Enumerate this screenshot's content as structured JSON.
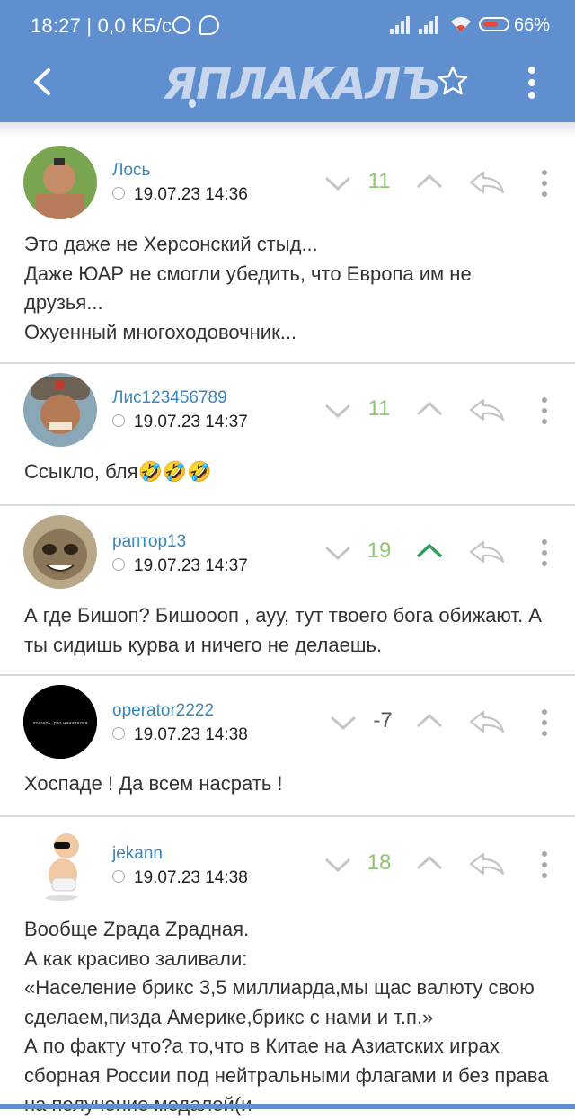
{
  "status_bar": {
    "time_text": "18:27 | 0,0 КБ/с",
    "battery_percent": "66%"
  },
  "header": {
    "logo_text": "ЯПЛАКАЛЪ",
    "back_icon": "chevron-left-icon",
    "favorite_icon": "star-outline-icon",
    "menu_icon": "vertical-dots-icon"
  },
  "colors": {
    "header": "#5f8fcf",
    "username": "#3a86b8",
    "positive_score": "#8dc770",
    "upvote_active": "#2e9c5a"
  },
  "comments": [
    {
      "username": "Лось",
      "date": "19.07.23 14:36",
      "score": "11",
      "upvoted": false,
      "text": "Это даже не Херсонский стыд...\nДаже ЮАР не смогли убедить, что Европа им не друзья...\nОхуенный многоходовочник..."
    },
    {
      "username": "Лис123456789",
      "date": "19.07.23 14:37",
      "score": "11",
      "upvoted": false,
      "text": "Ссыкло, бля🤣🤣🤣"
    },
    {
      "username": "раптор13",
      "date": "19.07.23 14:37",
      "score": "19",
      "upvoted": true,
      "text": "А где Бишоп? Бишоооп , ауу, тут твоего бога обижают. А ты сидишь курва и ничего не делаешь."
    },
    {
      "username": "operator2222",
      "date": "19.07.23 14:38",
      "score": "-7",
      "upvoted": false,
      "avatar_caption": "лошарь, раз начитался",
      "text": "Хоспаде ! Да всем насрать !"
    },
    {
      "username": "jekann",
      "date": "19.07.23 14:38",
      "score": "18",
      "upvoted": false,
      "text": "Вообще Zрада Zрадная.\nА как красиво заливали:\n«Население брикс 3,5 миллиарда,мы щас валюту свою сделаем,пизда Америке,брикс с нами и т.п.»\nА по факту что?а то,что в Китае на Азиатских играх сборная России под нейтральными флагами и без права на получение медалей(и"
    }
  ]
}
